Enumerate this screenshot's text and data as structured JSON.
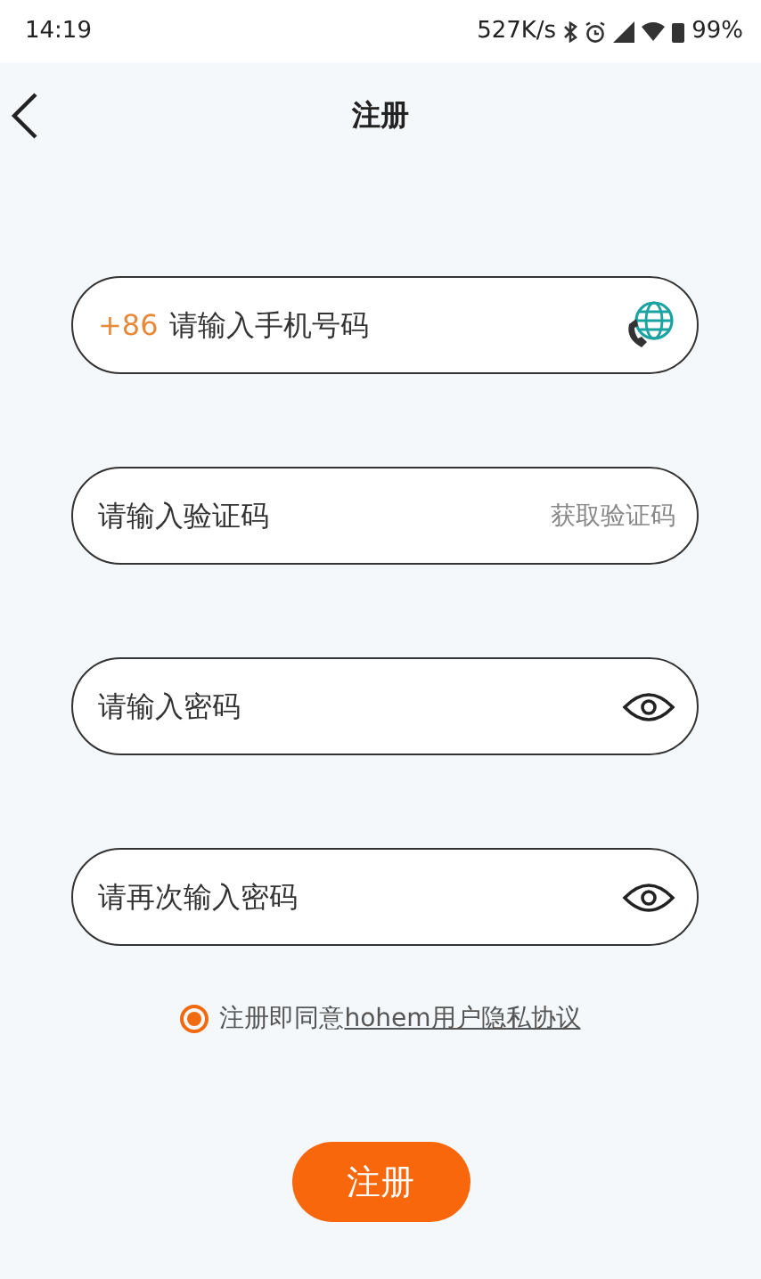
{
  "status_bar": {
    "time": "14:19",
    "speed": "527K/s",
    "battery": "99%"
  },
  "header": {
    "title": "注册"
  },
  "fields": [
    {
      "kind": "phone",
      "prefix": "+86",
      "placeholder": "请输入手机号码"
    },
    {
      "kind": "code",
      "placeholder": "请输入验证码",
      "action": "获取验证码"
    },
    {
      "kind": "password",
      "placeholder": "请输入密码"
    },
    {
      "kind": "password",
      "placeholder": "请再次输入密码"
    }
  ],
  "agreement": {
    "checked": true,
    "text": "注册即同意",
    "link": "hohem用户隐私协议"
  },
  "submit": {
    "label": "注册"
  }
}
